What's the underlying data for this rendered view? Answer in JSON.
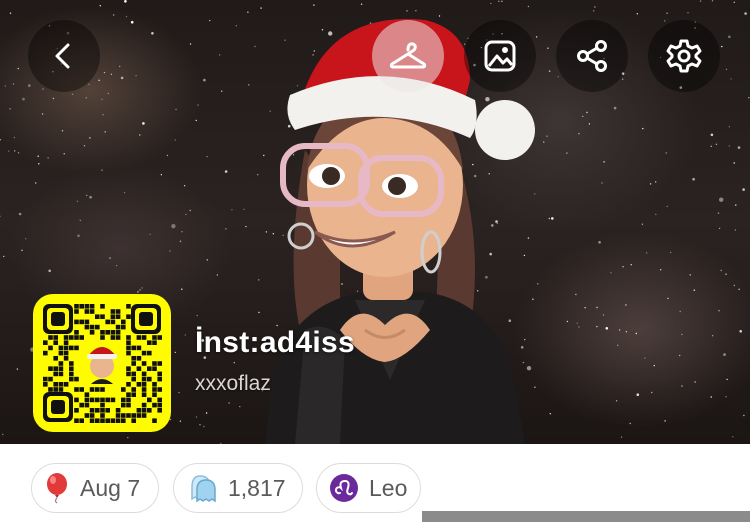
{
  "profile": {
    "display_name": "İnst:ad4iss",
    "username": "xxxoflaz"
  },
  "header": {
    "buttons": [
      {
        "name": "back-button",
        "icon": "chevron-left-icon"
      },
      {
        "name": "outfit-button",
        "icon": "hanger-icon"
      },
      {
        "name": "background-button",
        "icon": "image-icon"
      },
      {
        "name": "share-button",
        "icon": "share-icon"
      },
      {
        "name": "settings-button",
        "icon": "gear-icon"
      }
    ]
  },
  "pills": {
    "birthday": {
      "label": "Aug 7",
      "icon": "balloon-icon"
    },
    "friends": {
      "label": "1,817",
      "icon": "ghosts-icon"
    },
    "zodiac": {
      "label": "Leo",
      "icon": "leo-icon"
    }
  },
  "colors": {
    "snapchat_yellow": "#fffc00",
    "zodiac_purple": "#6a2a9c",
    "balloon_red": "#e23a3a",
    "ghost_blue": "#9fd3f0"
  }
}
